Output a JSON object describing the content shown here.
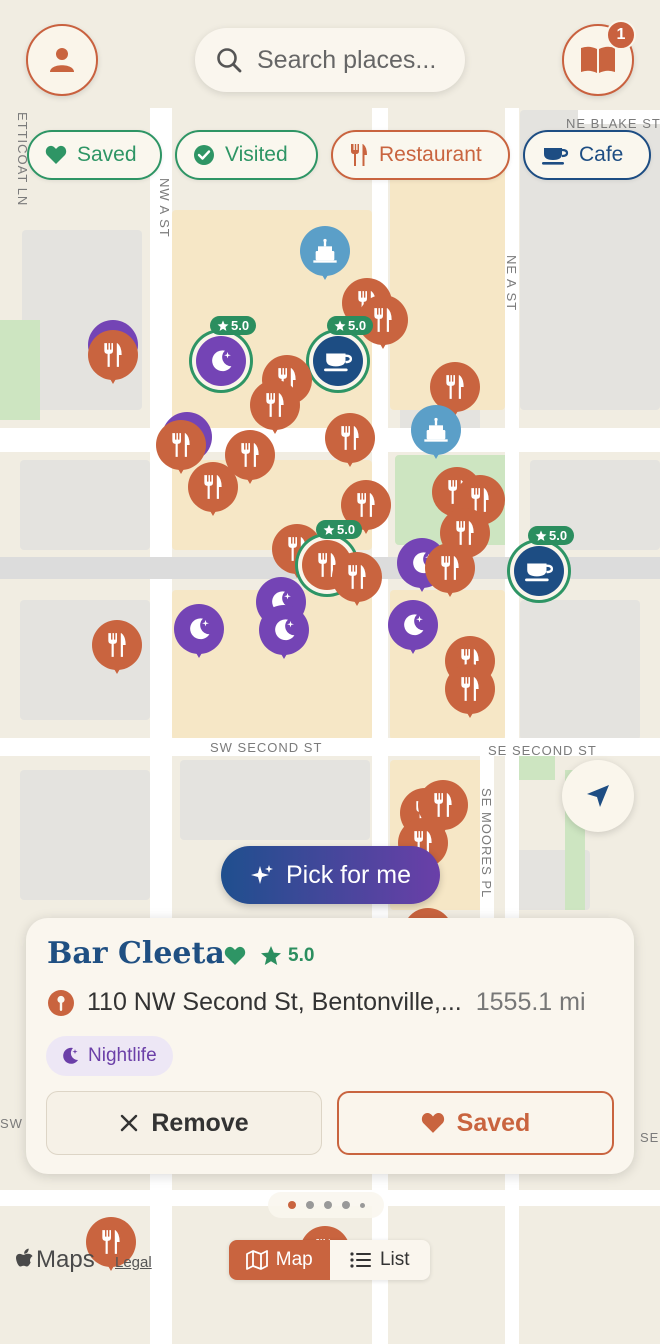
{
  "map": {
    "streets": [
      "NW A ST",
      "NE A ST",
      "NE BLAKE ST",
      "SW SECOND ST",
      "SE SECOND ST",
      "SE MOORES PL",
      "ETTICOAT LN",
      "SW",
      "SE"
    ]
  },
  "top_bar": {
    "profile_icon": "person-icon",
    "search_placeholder": "Search places...",
    "guide_icon": "book-icon",
    "guide_badge": "1"
  },
  "filters": [
    {
      "label": "Saved",
      "icon": "heart-icon",
      "color": "#2e9565"
    },
    {
      "label": "Visited",
      "icon": "check-circle-icon",
      "color": "#2e9565"
    },
    {
      "label": "Restaurant",
      "icon": "fork-knife-icon",
      "color": "#c9643f"
    },
    {
      "label": "Cafe",
      "icon": "coffee-cup-icon",
      "color": "#1d4d83"
    }
  ],
  "pins": {
    "rating_label": "5.0"
  },
  "pick_button": {
    "label": "Pick for me",
    "icon": "sparkles-icon"
  },
  "locate_icon": "location-arrow-icon",
  "place_card": {
    "name": "Bar Cleeta",
    "saved": true,
    "rating": "5.0",
    "address": "110 NW Second St, Bentonville,...",
    "distance": "1555.1 mi",
    "category": "Nightlife",
    "remove_label": "Remove",
    "saved_label": "Saved"
  },
  "pager": {
    "count": 5,
    "active_index": 0
  },
  "view_toggle": {
    "map_label": "Map",
    "list_label": "List",
    "active": "Map"
  },
  "attribution": {
    "brand": "Maps",
    "legal": "Legal"
  },
  "colors": {
    "accent": "#c9643f",
    "green": "#2e9565",
    "navy": "#1d4d83",
    "purple": "#7444b5",
    "background": "#f3eee2"
  }
}
